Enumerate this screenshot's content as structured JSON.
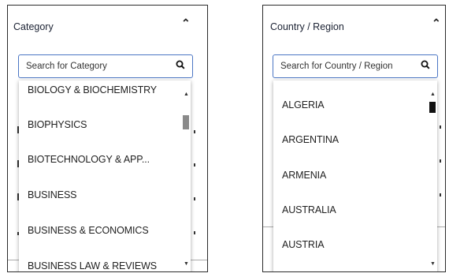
{
  "category": {
    "title": "Category",
    "search_placeholder": "Search for Category",
    "items": [
      "BIOLOGY & BIOCHEMISTRY",
      "BIOPHYSICS",
      "BIOTECHNOLOGY & APP...",
      "BUSINESS",
      "BUSINESS & ECONOMICS",
      "BUSINESS LAW & REVIEWS"
    ]
  },
  "country": {
    "title": "Country / Region",
    "search_placeholder": "Search for Country / Region",
    "items": [
      "ALGERIA",
      "ARGENTINA",
      "ARMENIA",
      "AUSTRALIA",
      "AUSTRIA"
    ]
  },
  "icons": {
    "collapse": "chevron-up-icon",
    "search": "search-icon",
    "scroll_up": "scroll-up-arrow-icon",
    "scroll_down": "scroll-down-arrow-icon"
  },
  "colors": {
    "search_border": "#4b76c4",
    "panel_border": "#2b2b2b",
    "scroll_thumb_category": "#8a8a8a",
    "scroll_thumb_country": "#111111"
  }
}
